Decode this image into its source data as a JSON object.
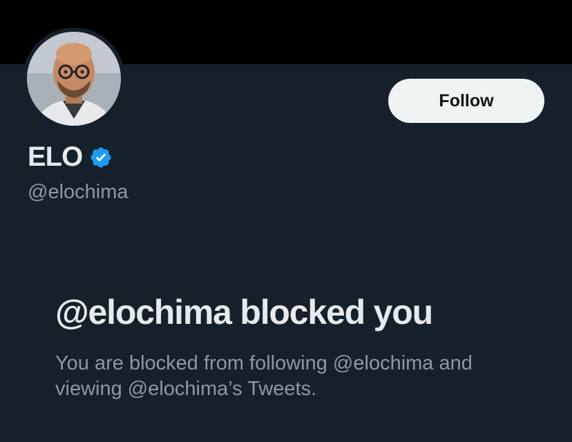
{
  "profile": {
    "display_name": "ELO",
    "handle": "@elochima",
    "verified": true,
    "avatar": "avatar-bald-man-glasses"
  },
  "actions": {
    "follow_label": "Follow"
  },
  "blocked": {
    "title": "@elochima blocked you",
    "message": "You are blocked from following @elochima and viewing @elochima’s Tweets."
  },
  "colors": {
    "background": "#15202b",
    "banner": "#000000",
    "primary_text": "#e7e9ea",
    "secondary_text": "#8b98a5",
    "verified": "#1d9bf0",
    "follow_button": "#eff3f4"
  },
  "icons": {
    "verified": "verified-badge-icon"
  }
}
